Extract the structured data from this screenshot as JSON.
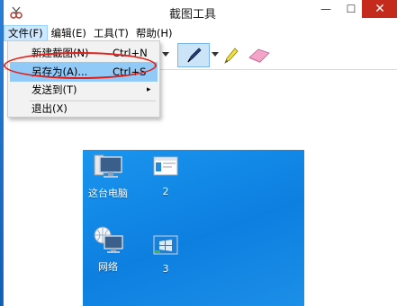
{
  "window": {
    "title": "截图工具",
    "min_symbol": "—",
    "max_symbol": "☐",
    "close_symbol": "✕"
  },
  "menubar": {
    "items": [
      {
        "label": "文件(F)",
        "active": true
      },
      {
        "label": "编辑(E)",
        "active": false
      },
      {
        "label": "工具(T)",
        "active": false
      },
      {
        "label": "帮助(H)",
        "active": false
      }
    ]
  },
  "file_menu": {
    "items": [
      {
        "label": "新建截图(N)",
        "shortcut": "Ctrl+N",
        "highlighted": false
      },
      {
        "label": "另存为(A)...",
        "shortcut": "Ctrl+S",
        "highlighted": true
      },
      {
        "label": "发送到(T)",
        "submenu_symbol": "▸"
      },
      {
        "label": "退出(X)"
      }
    ]
  },
  "desktop_icons": [
    {
      "label": "这台电脑",
      "icon": "computer-icon"
    },
    {
      "label": "2",
      "icon": "window-thumbnail-icon"
    },
    {
      "label": "网络",
      "icon": "network-icon"
    },
    {
      "label": "3",
      "icon": "windows-thumbnail-icon"
    }
  ],
  "colors": {
    "accent": "#cde8ff",
    "highlight": "#91c9f7",
    "annotation": "#e0201b",
    "close_button": "#c42b1c",
    "desktop_blue": "#0d7fe0"
  }
}
